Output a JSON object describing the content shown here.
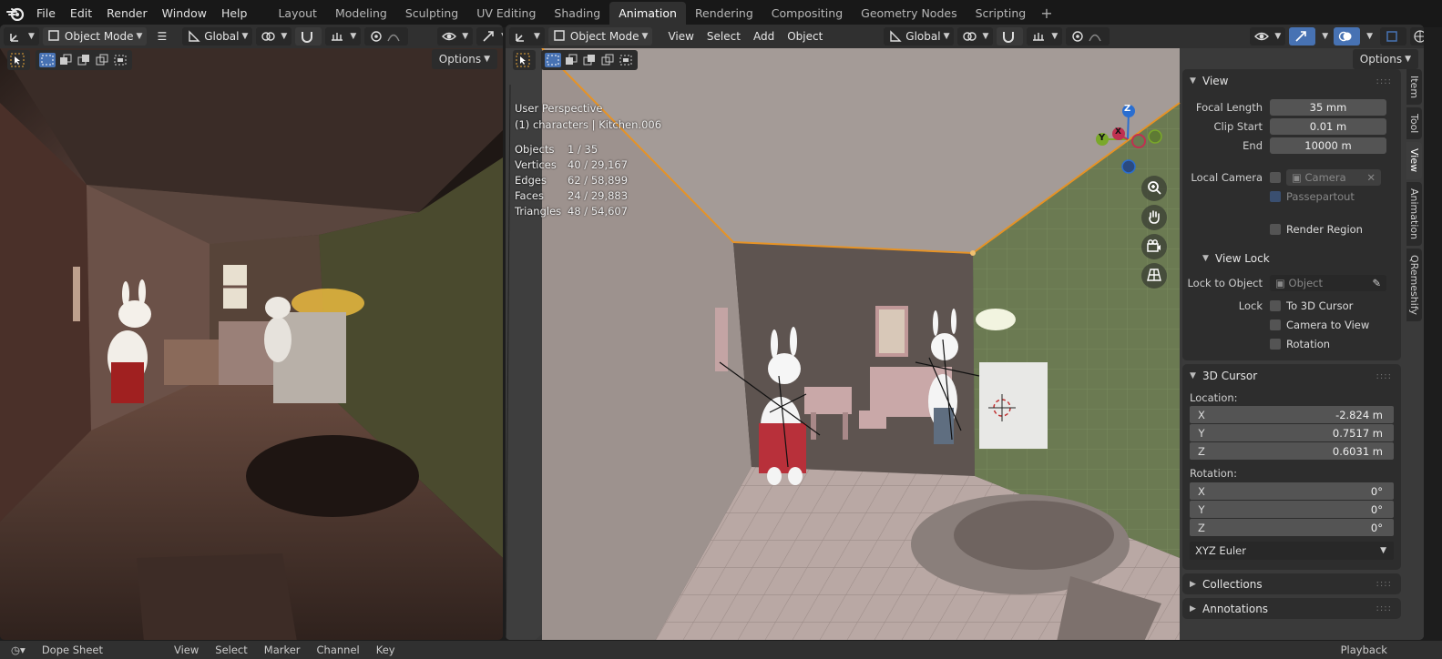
{
  "menus": [
    "File",
    "Edit",
    "Render",
    "Window",
    "Help"
  ],
  "workspaces": [
    "Layout",
    "Modeling",
    "Sculpting",
    "UV Editing",
    "Shading",
    "Animation",
    "Rendering",
    "Compositing",
    "Geometry Nodes",
    "Scripting"
  ],
  "active_workspace": "Animation",
  "left_viewport": {
    "mode": "Object Mode",
    "orientation": "Global",
    "options": "Options"
  },
  "right_viewport": {
    "mode": "Object Mode",
    "menu": [
      "View",
      "Select",
      "Add",
      "Object"
    ],
    "orientation": "Global",
    "options": "Options",
    "overlay_title": "User Perspective",
    "overlay_sub": "(1) characters | Kitchen.006",
    "stats": [
      {
        "k": "Objects",
        "v": "1 / 35"
      },
      {
        "k": "Vertices",
        "v": "40 / 29,167"
      },
      {
        "k": "Edges",
        "v": "62 / 58,899"
      },
      {
        "k": "Faces",
        "v": "24 / 29,883"
      },
      {
        "k": "Triangles",
        "v": "48 / 54,607"
      }
    ],
    "gizmo": {
      "z": "Z",
      "x": "X",
      "y": "Y"
    }
  },
  "npanel": {
    "view": {
      "title": "View",
      "focal_length_label": "Focal Length",
      "focal_length": "35 mm",
      "clip_start_label": "Clip Start",
      "clip_start": "0.01 m",
      "end_label": "End",
      "end": "10000 m",
      "local_camera_label": "Local Camera",
      "camera_placeholder": "Camera",
      "passepartout": "Passepartout",
      "render_region": "Render Region"
    },
    "view_lock": {
      "title": "View Lock",
      "lock_to_object_label": "Lock to Object",
      "object_placeholder": "Object",
      "lock_label": "Lock",
      "to_3d_cursor": "To 3D Cursor",
      "camera_to_view": "Camera to View",
      "rotation": "Rotation"
    },
    "cursor": {
      "title": "3D Cursor",
      "location_label": "Location:",
      "loc": [
        {
          "a": "X",
          "v": "-2.824 m"
        },
        {
          "a": "Y",
          "v": "0.7517 m"
        },
        {
          "a": "Z",
          "v": "0.6031 m"
        }
      ],
      "rotation_label": "Rotation:",
      "rot": [
        {
          "a": "X",
          "v": "0°"
        },
        {
          "a": "Y",
          "v": "0°"
        },
        {
          "a": "Z",
          "v": "0°"
        }
      ],
      "euler": "XYZ Euler"
    },
    "collections": "Collections",
    "annotations": "Annotations"
  },
  "side_tabs": [
    "Item",
    "Tool",
    "View",
    "Animation",
    "QRemeshify"
  ],
  "active_side_tab": "View",
  "bottom": [
    "Dope Sheet",
    "View",
    "Select",
    "Marker",
    "Channel",
    "Key",
    "Playback"
  ]
}
